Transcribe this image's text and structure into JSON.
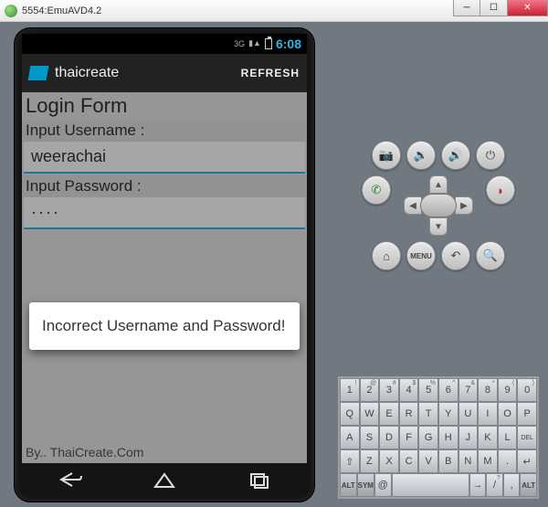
{
  "window": {
    "title": "5554:EmuAVD4.2"
  },
  "status": {
    "network": "3G",
    "time": "6:08"
  },
  "appbar": {
    "title": "thaicreate",
    "refresh": "REFRESH"
  },
  "form": {
    "title": "Login Form",
    "username_label": "Input Username :",
    "username_value": "weerachai",
    "password_label": "Input Password :",
    "password_value": "····",
    "footer": "By.. ThaiCreate.Com"
  },
  "toast": {
    "message": "Incorrect Username and Password!"
  },
  "ctl": {
    "menu_label": "MENU"
  },
  "kb": {
    "r1": [
      {
        "m": "1",
        "s": "!"
      },
      {
        "m": "2",
        "s": "@"
      },
      {
        "m": "3",
        "s": "#"
      },
      {
        "m": "4",
        "s": "$"
      },
      {
        "m": "5",
        "s": "%"
      },
      {
        "m": "6",
        "s": "^"
      },
      {
        "m": "7",
        "s": "&"
      },
      {
        "m": "8",
        "s": "*"
      },
      {
        "m": "9",
        "s": "("
      },
      {
        "m": "0",
        "s": ")"
      }
    ],
    "r2": [
      {
        "m": "Q"
      },
      {
        "m": "W"
      },
      {
        "m": "E"
      },
      {
        "m": "R"
      },
      {
        "m": "T"
      },
      {
        "m": "Y"
      },
      {
        "m": "U"
      },
      {
        "m": "I"
      },
      {
        "m": "O"
      },
      {
        "m": "P"
      }
    ],
    "r3": [
      {
        "m": "A"
      },
      {
        "m": "S"
      },
      {
        "m": "D"
      },
      {
        "m": "F"
      },
      {
        "m": "G"
      },
      {
        "m": "H"
      },
      {
        "m": "J"
      },
      {
        "m": "K"
      },
      {
        "m": "L"
      },
      {
        "m": "DEL",
        "s": ""
      }
    ],
    "r4": [
      {
        "m": "⇧"
      },
      {
        "m": "Z"
      },
      {
        "m": "X"
      },
      {
        "m": "C"
      },
      {
        "m": "V"
      },
      {
        "m": "B"
      },
      {
        "m": "N"
      },
      {
        "m": "M"
      },
      {
        "m": "."
      },
      {
        "m": "↵"
      }
    ],
    "r5": [
      {
        "m": "ALT"
      },
      {
        "m": "SYM"
      },
      {
        "m": "@"
      },
      {
        "m": " "
      },
      {
        "m": "→"
      },
      {
        "m": "/",
        "s": "?"
      },
      {
        "m": ",",
        "s": ""
      },
      {
        "m": "ALT"
      }
    ]
  }
}
